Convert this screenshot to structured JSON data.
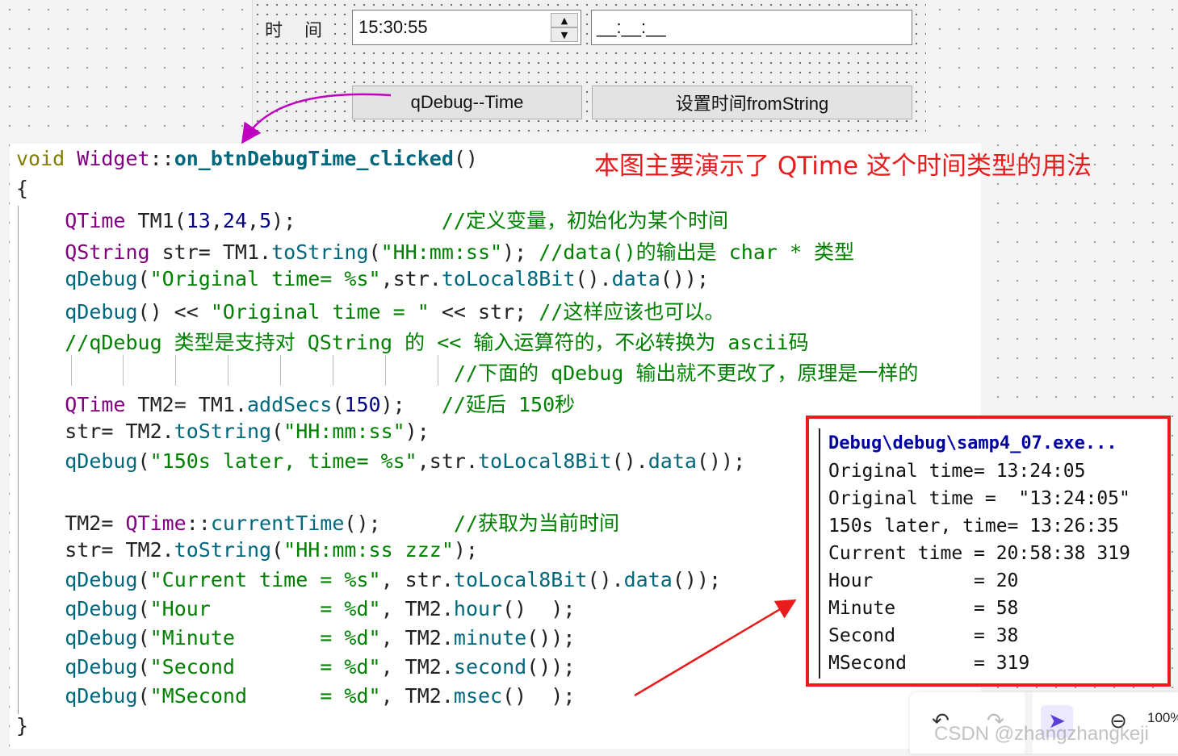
{
  "form": {
    "time_label": "时 间",
    "time_value": "15:30:55",
    "mask_value": "__:__:__",
    "btn_debug_time": "qDebug--Time",
    "btn_set_from_string": "设置时间fromString"
  },
  "code": {
    "lines": [
      {
        "parts": [
          [
            "kw",
            "void "
          ],
          [
            "ty",
            "Widget"
          ],
          [
            "bk",
            "::"
          ],
          [
            "fn",
            "on_btnDebugTime_clicked"
          ],
          [
            "bk",
            "()"
          ]
        ]
      },
      {
        "parts": [
          [
            "bk",
            "{"
          ]
        ]
      },
      {
        "parts": [
          [
            "bk",
            "    "
          ],
          [
            "ty",
            "QTime"
          ],
          [
            "bk",
            " TM1("
          ],
          [
            "nm",
            "13"
          ],
          [
            "bk",
            ","
          ],
          [
            "nm",
            "24"
          ],
          [
            "bk",
            ","
          ],
          [
            "nm",
            "5"
          ],
          [
            "bk",
            ");            "
          ],
          [
            "cm",
            "//定义变量，初始化为某个时间"
          ]
        ]
      },
      {
        "parts": [
          [
            "bk",
            "    "
          ],
          [
            "ty",
            "QString"
          ],
          [
            "bk",
            " str= TM1."
          ],
          [
            "mc",
            "toString"
          ],
          [
            "bk",
            "("
          ],
          [
            "st",
            "\"HH:mm:ss\""
          ],
          [
            "bk",
            "); "
          ],
          [
            "cm",
            "//data()的输出是 char * 类型"
          ]
        ]
      },
      {
        "parts": [
          [
            "bk",
            "    "
          ],
          [
            "mc",
            "qDebug"
          ],
          [
            "bk",
            "("
          ],
          [
            "st",
            "\"Original time= %s\""
          ],
          [
            "bk",
            ",str."
          ],
          [
            "mc",
            "toLocal8Bit"
          ],
          [
            "bk",
            "()."
          ],
          [
            "mc",
            "data"
          ],
          [
            "bk",
            "());"
          ]
        ]
      },
      {
        "parts": [
          [
            "bk",
            "    "
          ],
          [
            "mc",
            "qDebug"
          ],
          [
            "bk",
            "() << "
          ],
          [
            "st",
            "\"Original time = \""
          ],
          [
            "bk",
            " << str; "
          ],
          [
            "cm",
            "//这样应该也可以。"
          ]
        ]
      },
      {
        "parts": [
          [
            "bk",
            "    "
          ],
          [
            "cm",
            "//qDebug 类型是支持对 QString 的 << 输入运算符的，不必转换为 ascii码"
          ]
        ]
      },
      {
        "parts": [
          [
            "bk",
            "                                    "
          ],
          [
            "cm",
            "//下面的 qDebug 输出就不更改了，原理是一样的"
          ]
        ]
      },
      {
        "parts": [
          [
            "bk",
            "    "
          ],
          [
            "ty",
            "QTime"
          ],
          [
            "bk",
            " TM2= TM1."
          ],
          [
            "mc",
            "addSecs"
          ],
          [
            "bk",
            "("
          ],
          [
            "nm",
            "150"
          ],
          [
            "bk",
            ");   "
          ],
          [
            "cm",
            "//延后 150秒"
          ]
        ]
      },
      {
        "parts": [
          [
            "bk",
            "    str= TM2."
          ],
          [
            "mc",
            "toString"
          ],
          [
            "bk",
            "("
          ],
          [
            "st",
            "\"HH:mm:ss\""
          ],
          [
            "bk",
            ");"
          ]
        ]
      },
      {
        "parts": [
          [
            "bk",
            "    "
          ],
          [
            "mc",
            "qDebug"
          ],
          [
            "bk",
            "("
          ],
          [
            "st",
            "\"150s later, time= %s\""
          ],
          [
            "bk",
            ",str."
          ],
          [
            "mc",
            "toLocal8Bit"
          ],
          [
            "bk",
            "()."
          ],
          [
            "mc",
            "data"
          ],
          [
            "bk",
            "());"
          ]
        ]
      },
      {
        "parts": [
          [
            "bk",
            ""
          ]
        ]
      },
      {
        "parts": [
          [
            "bk",
            "    TM2= "
          ],
          [
            "ty",
            "QTime"
          ],
          [
            "bk",
            "::"
          ],
          [
            "mc",
            "currentTime"
          ],
          [
            "bk",
            "();      "
          ],
          [
            "cm",
            "//获取为当前时间"
          ]
        ]
      },
      {
        "parts": [
          [
            "bk",
            "    str= TM2."
          ],
          [
            "mc",
            "toString"
          ],
          [
            "bk",
            "("
          ],
          [
            "st",
            "\"HH:mm:ss zzz\""
          ],
          [
            "bk",
            ");"
          ]
        ]
      },
      {
        "parts": [
          [
            "bk",
            "    "
          ],
          [
            "mc",
            "qDebug"
          ],
          [
            "bk",
            "("
          ],
          [
            "st",
            "\"Current time = %s\""
          ],
          [
            "bk",
            ", str."
          ],
          [
            "mc",
            "toLocal8Bit"
          ],
          [
            "bk",
            "()."
          ],
          [
            "mc",
            "data"
          ],
          [
            "bk",
            "());"
          ]
        ]
      },
      {
        "parts": [
          [
            "bk",
            "    "
          ],
          [
            "mc",
            "qDebug"
          ],
          [
            "bk",
            "("
          ],
          [
            "st",
            "\"Hour         = %d\""
          ],
          [
            "bk",
            ", TM2."
          ],
          [
            "mc",
            "hour"
          ],
          [
            "bk",
            "()  );"
          ]
        ]
      },
      {
        "parts": [
          [
            "bk",
            "    "
          ],
          [
            "mc",
            "qDebug"
          ],
          [
            "bk",
            "("
          ],
          [
            "st",
            "\"Minute       = %d\""
          ],
          [
            "bk",
            ", TM2."
          ],
          [
            "mc",
            "minute"
          ],
          [
            "bk",
            "());"
          ]
        ]
      },
      {
        "parts": [
          [
            "bk",
            "    "
          ],
          [
            "mc",
            "qDebug"
          ],
          [
            "bk",
            "("
          ],
          [
            "st",
            "\"Second       = %d\""
          ],
          [
            "bk",
            ", TM2."
          ],
          [
            "mc",
            "second"
          ],
          [
            "bk",
            "());"
          ]
        ]
      },
      {
        "parts": [
          [
            "bk",
            "    "
          ],
          [
            "mc",
            "qDebug"
          ],
          [
            "bk",
            "("
          ],
          [
            "st",
            "\"MSecond      = %d\""
          ],
          [
            "bk",
            ", TM2."
          ],
          [
            "mc",
            "msec"
          ],
          [
            "bk",
            "()  );"
          ]
        ]
      },
      {
        "parts": [
          [
            "bk",
            "}"
          ]
        ]
      }
    ]
  },
  "annotation": "本图主要演示了 QTime 这个时间类型的用法",
  "console": {
    "title": "Debug\\debug\\samp4_07.exe...",
    "lines": [
      "Original time= 13:24:05",
      "Original time =  \"13:24:05\"",
      "150s later, time= 13:26:35",
      "Current time = 20:58:38 319",
      "Hour         = 20",
      "Minute       = 58",
      "Second       = 38",
      "MSecond      = 319"
    ]
  },
  "toolbar": {
    "zoom": "100%"
  },
  "watermark": "CSDN @zhangzhangkeji",
  "colors": {
    "annotation_red": "#e81c1c",
    "arrow_magenta": "#c000c0"
  }
}
